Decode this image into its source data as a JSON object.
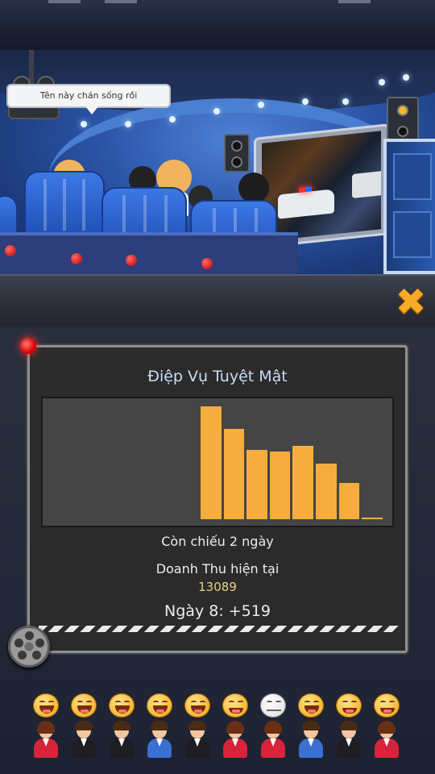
{
  "scene": {
    "speech_bubble": "Tên này chán sống rồi"
  },
  "panel": {
    "movie_title": "Điệp Vụ Tuyệt Mật",
    "days_remaining": "Còn chiếu 2 ngày",
    "revenue_label": "Doanh Thu hiện tại",
    "revenue_value": "13089",
    "day_change": "Ngày 8: +519"
  },
  "chart_data": {
    "type": "bar",
    "slots": 10,
    "values": [
      0,
      0,
      0,
      0,
      0,
      0.97,
      0.78,
      0.6,
      0.58,
      0.63,
      0.48,
      0.31,
      0.01
    ],
    "filled_from_slot": 6,
    "bar_values": [
      0.97,
      0.78,
      0.6,
      0.58,
      0.63,
      0.48,
      0.31,
      0.01
    ],
    "ylim": [
      0,
      1
    ],
    "grid": false,
    "color": "#f6ad3d",
    "background": "#454545"
  },
  "audience": {
    "reactions": [
      "laugh",
      "laugh",
      "laugh",
      "laugh",
      "laugh",
      "smile",
      "neutral",
      "laugh",
      "smile",
      "smile"
    ],
    "viewers": [
      {
        "gender": "female",
        "outfit": "#d8243a"
      },
      {
        "gender": "male",
        "outfit": "#1e1e22"
      },
      {
        "gender": "male",
        "outfit": "#1e1e22"
      },
      {
        "gender": "male",
        "outfit": "#3b6fd0"
      },
      {
        "gender": "male",
        "outfit": "#1e1e22"
      },
      {
        "gender": "female",
        "outfit": "#d8243a"
      },
      {
        "gender": "female",
        "outfit": "#d8243a"
      },
      {
        "gender": "male",
        "outfit": "#3b6fd0"
      },
      {
        "gender": "male",
        "outfit": "#1e1e22"
      },
      {
        "gender": "female",
        "outfit": "#d8243a"
      }
    ]
  },
  "colors": {
    "accent": "#f7a928",
    "bar": "#f6ad3d",
    "title": "#c9dcf3",
    "revenue": "#f0cf7c"
  }
}
